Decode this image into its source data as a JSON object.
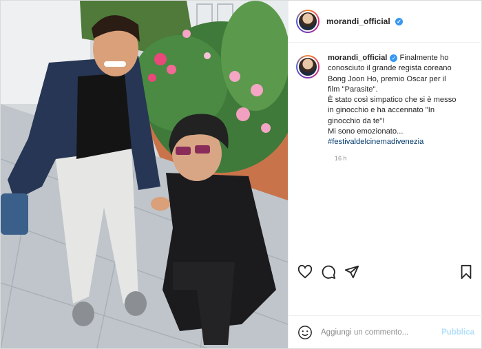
{
  "header": {
    "username": "morandi_official",
    "verified_icon": "verified-badge-icon",
    "accent_color": "#3897f0"
  },
  "caption": {
    "username": "morandi_official",
    "lines": [
      "Finalmente ho",
      "conosciuto il grande regista coreano",
      "Bong Joon Ho, premio Oscar per il",
      "film \"Parasite\".",
      "È stato così simpatico che si è messo",
      "in ginocchio e ha accennato \"In",
      "ginocchio da te\"!",
      "Mi sono emozionato..."
    ],
    "hashtag": "#festivaldelcinemadivenezia",
    "time": "16 h"
  },
  "actions": {
    "icons": [
      "heart-icon",
      "comment-icon",
      "share-icon",
      "bookmark-icon"
    ]
  },
  "comment_box": {
    "placeholder": "Aggiungi un commento...",
    "publish_label": "Pubblica",
    "publish_color": "#b2dffc"
  }
}
